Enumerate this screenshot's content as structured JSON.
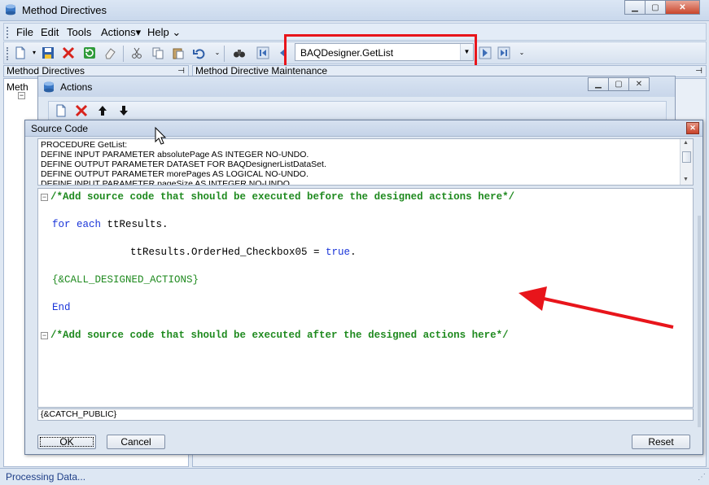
{
  "window": {
    "title": "Method Directives",
    "min_glyph": "▁",
    "max_glyph": "▢",
    "close_glyph": "✕"
  },
  "menu": {
    "items": [
      {
        "label": "File"
      },
      {
        "label": "Edit"
      },
      {
        "label": "Tools"
      },
      {
        "label": "Actions▾"
      },
      {
        "label": "Help ⌄"
      }
    ]
  },
  "toolbar": {
    "method_combo_value": "BAQDesigner.GetList"
  },
  "panels": {
    "left_title": "Method Directives",
    "left_tree_item": "Meth",
    "right_title": "Method Directive Maintenance",
    "pin_glyph": "⊣"
  },
  "actions_window": {
    "title": "Actions"
  },
  "source_dialog": {
    "title": "Source Code",
    "close_glyph": "✕",
    "header_lines": [
      "PROCEDURE GetList:",
      "DEFINE INPUT PARAMETER absolutePage AS INTEGER NO-UNDO.",
      "DEFINE OUTPUT PARAMETER DATASET FOR BAQDesignerListDataSet.",
      "DEFINE OUTPUT PARAMETER morePages AS LOGICAL NO-UNDO.",
      "DEFINE INPUT PARAMETER pageSize AS INTEGER NO-UNDO."
    ],
    "code": {
      "comment_before": "/*Add source code that should be executed before the designed actions here*/",
      "for_each_kw": "for each",
      "for_each_rest": " ttResults.",
      "assign_lhs": "ttResults.OrderHed_Checkbox05 = ",
      "assign_true": "true",
      "assign_end": ".",
      "call_actions": "{&CALL_DESIGNED_ACTIONS}",
      "end_kw": "End",
      "comment_after": "/*Add source code that should be executed after the designed actions here*/"
    },
    "footer_line": "{&CATCH_PUBLIC}",
    "ok_label": "OK",
    "cancel_label": "Cancel",
    "reset_label": "Reset"
  },
  "status": {
    "text": "Processing Data..."
  },
  "colors": {
    "highlight_red": "#e8151b",
    "comment_green": "#1f8a1f",
    "keyword_blue": "#1a35d9"
  }
}
